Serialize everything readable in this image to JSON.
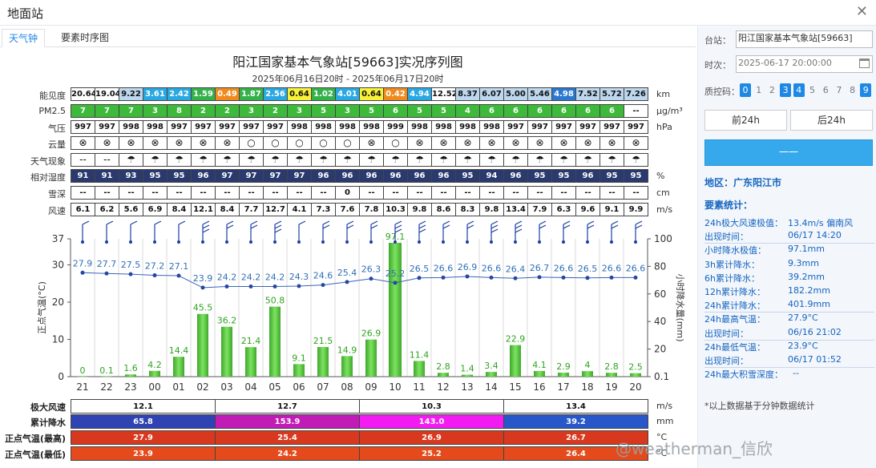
{
  "dialog": {
    "title": "地面站"
  },
  "tabs": [
    {
      "label": "天气钟"
    },
    {
      "label": "要素时序图"
    }
  ],
  "main": {
    "title": "阳江国家基本气象站[59663]实况序列图",
    "subtitle": "2025年06月16日20时 - 2025年06月17日20时"
  },
  "labels": {
    "vis": "能见度",
    "pm25": "PM2.5",
    "pres": "气压",
    "cloud": "云量",
    "wx": "天气现象",
    "rh": "相对湿度",
    "snow": "雪深",
    "wind": "风速"
  },
  "units": {
    "vis": "km",
    "pm25": "μg/m³",
    "pres": "hPa",
    "rh": "%",
    "snow": "cm",
    "wind": "m/s",
    "sum_wind": "m/s",
    "sum_rain": "mm",
    "sum_tmax": "°C",
    "sum_tmin": "°C"
  },
  "rows": {
    "vis": [
      "20.64",
      "19.04",
      "9.22",
      "3.61",
      "2.42",
      "1.59",
      "0.49",
      "1.87",
      "2.56",
      "0.64",
      "1.02",
      "4.01",
      "0.64",
      "0.42",
      "4.94",
      "12.52",
      "8.37",
      "6.07",
      "5.00",
      "5.46",
      "4.98",
      "7.52",
      "5.72",
      "7.26"
    ],
    "vis_colors": [
      "#ffffff",
      "#ffffff",
      "#bcd7ee",
      "#29a8e2",
      "#29a8e2",
      "#34b24a",
      "#f08a1f",
      "#34b24a",
      "#29a8e2",
      "#f7f137",
      "#34b24a",
      "#29a8e2",
      "#f7f137",
      "#f08a1f",
      "#29a8e2",
      "#ffffff",
      "#bcd7ee",
      "#bcd7ee",
      "#bcd7ee",
      "#bcd7ee",
      "#2a78d0",
      "#bcd7ee",
      "#bcd7ee",
      "#bcd7ee"
    ],
    "pm25": [
      "7",
      "7",
      "7",
      "3",
      "8",
      "2",
      "2",
      "3",
      "2",
      "3",
      "5",
      "3",
      "5",
      "6",
      "5",
      "5",
      "4",
      "6",
      "6",
      "6",
      "6",
      "6",
      "6",
      "--"
    ],
    "pres": [
      "997",
      "997",
      "998",
      "998",
      "997",
      "997",
      "997",
      "997",
      "997",
      "998",
      "998",
      "998",
      "998",
      "999",
      "998",
      "998",
      "998",
      "998",
      "997",
      "997",
      "997",
      "997",
      "997",
      "997"
    ],
    "cloud": [
      "⊗",
      "⊗",
      "⊗",
      "⊗",
      "⊗",
      "⊗",
      "⊗",
      "○",
      "○",
      "○",
      "○",
      "○",
      "⊗",
      "○",
      "⊗",
      "⊗",
      "⊗",
      "⊗",
      "⊗",
      "⊗",
      "⊗",
      "⊗",
      "⊗",
      "⊗"
    ],
    "wx": [
      "--",
      "--",
      "☂",
      "☂",
      "☂",
      "☂",
      "☂",
      "☂",
      "☂",
      "☂",
      "☂",
      "☂",
      "☂",
      "☂",
      "☂",
      "☂",
      "☂",
      "☂",
      "☂",
      "☂",
      "☂",
      "☂",
      "☂",
      "☂"
    ],
    "rh": [
      "91",
      "91",
      "93",
      "95",
      "95",
      "96",
      "97",
      "97",
      "97",
      "97",
      "96",
      "96",
      "96",
      "96",
      "96",
      "96",
      "95",
      "94",
      "96",
      "95",
      "95",
      "96",
      "95",
      "95"
    ],
    "snow": [
      "--",
      "--",
      "--",
      "--",
      "--",
      "--",
      "--",
      "--",
      "--",
      "--",
      "--",
      "0",
      "--",
      "--",
      "--",
      "--",
      "--",
      "--",
      "--",
      "--",
      "--",
      "--",
      "--",
      "--"
    ],
    "wind": [
      "6.1",
      "6.2",
      "5.6",
      "6.9",
      "8.4",
      "12.1",
      "8.4",
      "7.7",
      "12.7",
      "4.1",
      "7.3",
      "7.6",
      "7.8",
      "10.3",
      "9.8",
      "8.6",
      "8.3",
      "9.8",
      "13.4",
      "7.9",
      "6.3",
      "9.6",
      "9.1",
      "9.9"
    ]
  },
  "chart_data": {
    "type": "bar",
    "categories": [
      "21",
      "22",
      "23",
      "00",
      "01",
      "02",
      "03",
      "04",
      "05",
      "06",
      "07",
      "08",
      "09",
      "10",
      "11",
      "12",
      "13",
      "14",
      "15",
      "16",
      "17",
      "18",
      "19",
      "20"
    ],
    "series": [
      {
        "values": [
          0,
          0.1,
          1.6,
          4.2,
          14.4,
          45.5,
          36.2,
          21.4,
          50.8,
          9.1,
          21.5,
          14.9,
          26.9,
          97.1,
          11.4,
          2.8,
          1.4,
          3.4,
          22.9,
          4.1,
          2.9,
          4,
          2.8,
          2.5
        ]
      },
      {
        "values": [
          27.9,
          27.7,
          27.5,
          27.2,
          27.1,
          23.9,
          24.2,
          24.2,
          24.2,
          24.3,
          24.6,
          25.4,
          26.3,
          25.2,
          26.5,
          26.6,
          26.9,
          26.6,
          26.4,
          26.7,
          26.6,
          26.5,
          26.6,
          26.6
        ]
      }
    ],
    "ylabel": "正点气温(°C)",
    "y2label": "小时降水量(mm)",
    "ylim": [
      0,
      37
    ],
    "yticks": [
      0,
      10,
      20,
      30,
      37
    ],
    "y2ticks": [
      "0.1",
      "20",
      "40",
      "60",
      "80",
      "100"
    ],
    "grid": true,
    "wind_barbs": [
      4,
      4,
      4,
      4,
      4,
      12,
      8,
      8,
      12,
      4,
      6,
      6,
      6,
      10,
      10,
      8,
      8,
      10,
      12,
      6,
      6,
      8,
      8,
      8
    ]
  },
  "summary": {
    "labels": [
      "极大风速",
      "累计降水",
      "正点气温(最高)",
      "正点气温(最低)"
    ],
    "wind": [
      "12.1",
      "12.7",
      "10.3",
      "13.4"
    ],
    "rain": [
      "65.8",
      "153.9",
      "143.0",
      "39.2"
    ],
    "rain_colors": [
      "#2f43b3",
      "#c21cb7",
      "#f21cf2",
      "#2757c9"
    ],
    "tmax": [
      "27.9",
      "25.4",
      "26.9",
      "26.7"
    ],
    "tmin": [
      "23.9",
      "24.2",
      "25.2",
      "26.4"
    ]
  },
  "side": {
    "station_label": "台站：",
    "station_value": "阳江国家基本气象站[59663]",
    "time_label": "时次：",
    "time_value": "2025-06-17 20:00:00",
    "qc_label": "质控码：",
    "qc_codes": [
      "0",
      "1",
      "2",
      "3",
      "4",
      "5",
      "6",
      "7",
      "8",
      "9"
    ],
    "qc_on": [
      0,
      3,
      4,
      9
    ],
    "prev_btn": "前24h",
    "next_btn": "后24h",
    "query_btn": "一一",
    "region": "地区：广东阳江市",
    "stats_title": "要素统计：",
    "stats": [
      {
        "k": "24h极大风速极值：",
        "v": "13.4m/s 偏南风"
      },
      {
        "k": "出现时间：",
        "v": "06/17 14:20"
      },
      {
        "k": "小时降水极值：",
        "v": "97.1mm"
      },
      {
        "k": "3h累计降水：",
        "v": "9.3mm"
      },
      {
        "k": "6h累计降水：",
        "v": "39.2mm"
      },
      {
        "k": "12h累计降水：",
        "v": "182.2mm"
      },
      {
        "k": "24h累计降水：",
        "v": "401.9mm"
      },
      {
        "k": "24h最高气温：",
        "v": "27.9°C"
      },
      {
        "k": "出现时间：",
        "v": "06/16 21:02"
      },
      {
        "k": "24h最低气温：",
        "v": "23.9°C"
      },
      {
        "k": "出现时间：",
        "v": "06/17 01:52"
      },
      {
        "k": "24h最大积雪深度：",
        "v": "--"
      }
    ],
    "note": "*以上数据基于分钟数据统计"
  },
  "watermark": "@weatherman_信欣"
}
